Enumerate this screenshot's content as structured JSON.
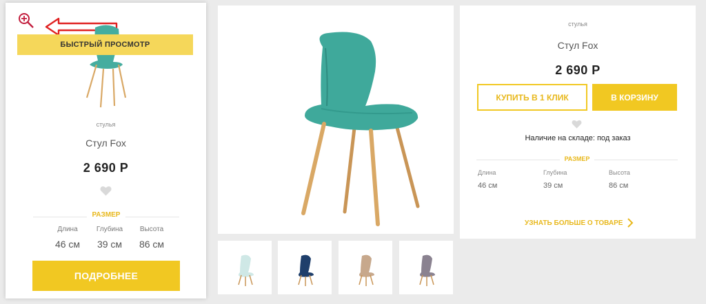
{
  "card": {
    "quick_view_label": "БЫСТРЫЙ ПРОСМОТР",
    "category": "стулья",
    "name": "Стул Fox",
    "price": "2 690 Р",
    "size_title": "РАЗМЕР",
    "dimensions": [
      {
        "label": "Длина",
        "value": "46 см"
      },
      {
        "label": "Глубина",
        "value": "39 см"
      },
      {
        "label": "Высота",
        "value": "86 см"
      }
    ],
    "more_button": "ПОДРОБНЕЕ",
    "icons": {
      "zoom": "zoom-in-icon",
      "favorite": "heart-icon",
      "annotation": "red-arrow-icon"
    }
  },
  "detail": {
    "category": "стулья",
    "name": "Стул Fox",
    "price": "2 690 Р",
    "buy_one_click": "КУПИТЬ В 1 КЛИК",
    "to_cart": "В КОРЗИНУ",
    "stock": "Наличие на складе: под заказ",
    "size_title": "РАЗМЕР",
    "dimensions": [
      {
        "label": "Длина",
        "value": "46 см"
      },
      {
        "label": "Глубина",
        "value": "39 см"
      },
      {
        "label": "Высота",
        "value": "86 см"
      }
    ],
    "learn_more": "УЗНАТЬ БОЛЬШЕ О ТОВАРЕ",
    "icons": {
      "favorite": "heart-icon",
      "arrow": "chevron-right-icon"
    }
  },
  "thumbnails": [
    {
      "color": "#cfe8e6"
    },
    {
      "color": "#1f3f6b"
    },
    {
      "color": "#c7a88c"
    },
    {
      "color": "#8a8290"
    }
  ],
  "colors": {
    "accent": "#f1c822",
    "accent_text": "#e8b81c",
    "main_chair": "#3fa99b",
    "wood": "#d9a865"
  }
}
